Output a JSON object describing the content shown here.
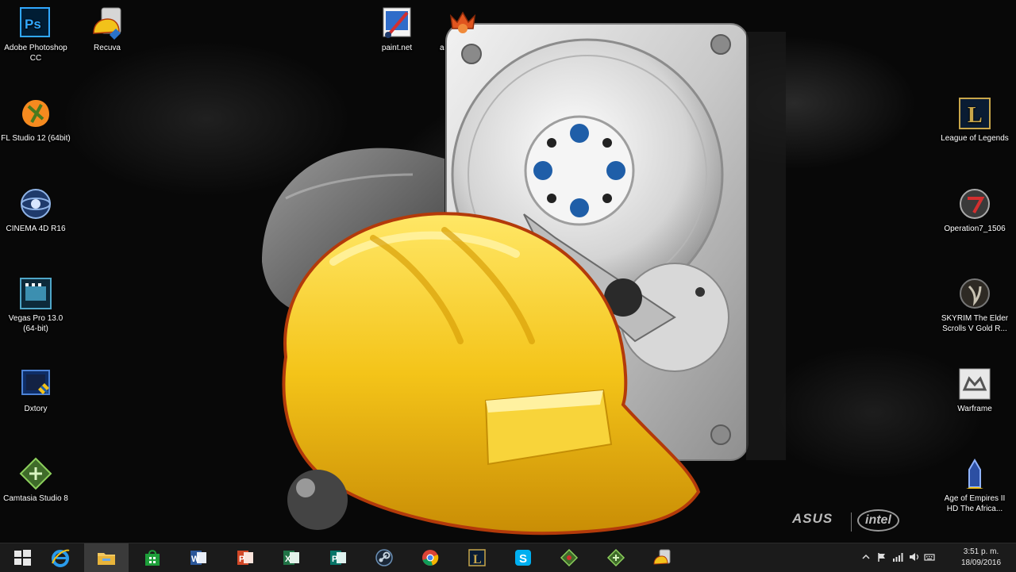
{
  "desktop": {
    "left_icons": [
      {
        "label": "Adobe Photoshop CC",
        "icon": "photoshop-icon"
      },
      {
        "label": "Recuva",
        "icon": "recuva-icon"
      },
      {
        "label": "FL Studio 12 (64bit)",
        "icon": "fl-studio-icon"
      },
      {
        "label": "CINEMA 4D R16",
        "icon": "cinema4d-icon"
      },
      {
        "label": "Vegas Pro 13.0 (64-bit)",
        "icon": "vegas-pro-icon"
      },
      {
        "label": "Dxtory",
        "icon": "dxtory-icon"
      },
      {
        "label": "Camtasia Studio 8",
        "icon": "camtasia-icon"
      }
    ],
    "top_icons": [
      {
        "label": "paint.net",
        "icon": "paint-net-icon"
      },
      {
        "label": "a",
        "icon": "app-crown-icon"
      }
    ],
    "right_icons": [
      {
        "label": "League of Legends",
        "icon": "league-of-legends-icon"
      },
      {
        "label": "Operation7_1506",
        "icon": "operation7-icon"
      },
      {
        "label": "SKYRIM The Elder Scrolls V Gold R...",
        "icon": "skyrim-icon"
      },
      {
        "label": "Warframe",
        "icon": "warframe-icon"
      },
      {
        "label": "Age of Empires II HD The Africa...",
        "icon": "age-of-empires-icon"
      }
    ]
  },
  "wallpaper": {
    "brand_asus": "ASUS",
    "brand_intel": "intel",
    "artwork": "recuva-hard-drive-helmet-logo"
  },
  "taskbar": {
    "buttons": [
      {
        "icon": "windows-start-icon",
        "active": false
      },
      {
        "icon": "internet-explorer-icon",
        "active": false
      },
      {
        "icon": "file-explorer-icon",
        "active": true
      },
      {
        "icon": "windows-store-icon",
        "active": false
      },
      {
        "icon": "word-icon",
        "active": false
      },
      {
        "icon": "powerpoint-icon",
        "active": false
      },
      {
        "icon": "excel-icon",
        "active": false
      },
      {
        "icon": "publisher-icon",
        "active": false
      },
      {
        "icon": "steam-icon",
        "active": false
      },
      {
        "icon": "chrome-icon",
        "active": false
      },
      {
        "icon": "league-launcher-icon",
        "active": false
      },
      {
        "icon": "skype-icon",
        "active": false
      },
      {
        "icon": "camtasia-recorder-icon",
        "active": false
      },
      {
        "icon": "camtasia-studio-icon",
        "active": false
      },
      {
        "icon": "recuva-taskbar-icon",
        "active": false
      }
    ],
    "tray": {
      "icons": [
        "show-hidden-icons-icon",
        "flag-icon",
        "network-icon",
        "volume-icon",
        "keyboard-icon"
      ],
      "time": "3:51 p. m.",
      "date": "18/09/2016"
    }
  },
  "colors": {
    "helmet_yellow": "#f2c21a",
    "taskbar_bg": "#1b1b1b",
    "disk_blue": "#1f5ea8"
  }
}
